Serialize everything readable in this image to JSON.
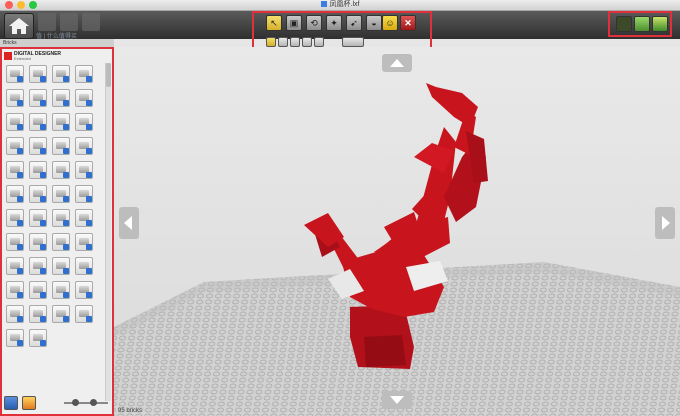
{
  "window": {
    "title": "凤凰杯.lxf"
  },
  "toolbar": {
    "watermark": "值 | 什么值得买",
    "tools": [
      {
        "icon": "select-arrow-icon",
        "glyph": "↖"
      },
      {
        "icon": "clone-brick-icon",
        "glyph": "▣"
      },
      {
        "icon": "hinge-icon",
        "glyph": "⟲"
      },
      {
        "icon": "hinge-align-icon",
        "glyph": "✦"
      },
      {
        "icon": "flex-icon",
        "glyph": "➹"
      },
      {
        "icon": "paint-bucket-icon",
        "glyph": "◒"
      },
      {
        "icon": "minifig-paint-icon",
        "glyph": "☺"
      },
      {
        "icon": "delete-icon",
        "glyph": "✕"
      }
    ],
    "subtools": [
      "single-select-icon",
      "connected-select-icon",
      "same-color-select-icon",
      "same-shape-select-icon",
      "invert-select-icon"
    ],
    "hide_button": "hide-icon"
  },
  "modes": [
    {
      "icon": "build-mode-icon",
      "color": "#3c4a2a"
    },
    {
      "icon": "view-mode-icon",
      "color": "#6fb840"
    },
    {
      "icon": "building-guide-icon",
      "color": "#4b8f2c"
    }
  ],
  "palette": {
    "tab": "Bricks",
    "title": "DIGITAL DESIGNER",
    "subtitle": "Extended",
    "brick_count": 46
  },
  "viewport": {
    "status": "95 bricks"
  },
  "colors": {
    "accent": "#e0303a",
    "brick_red": "#c8141c",
    "baseplate": "#d4d4d4"
  }
}
